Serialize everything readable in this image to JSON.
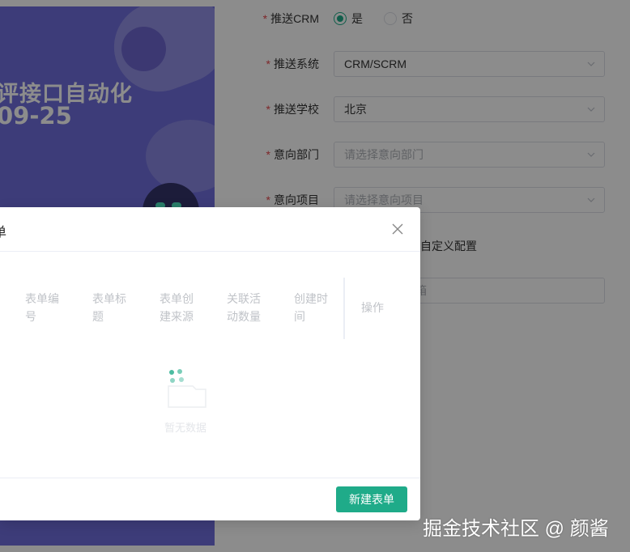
{
  "banner": {
    "title": "评接口自动化",
    "date": "09-25"
  },
  "form": {
    "push_crm": {
      "label": "推送CRM",
      "options": [
        {
          "label": "是",
          "checked": true
        },
        {
          "label": "否",
          "checked": false
        }
      ]
    },
    "push_system": {
      "label": "推送系统",
      "value": "CRM/SCRM"
    },
    "push_school": {
      "label": "推送学校",
      "value": "北京"
    },
    "intent_department": {
      "label": "意向部门",
      "placeholder": "请选择意向部门"
    },
    "intent_project": {
      "label": "意向项目",
      "placeholder": "请选择意向项目"
    },
    "custom_config_label": "自定义配置",
    "email_placeholder_fragment": "箱"
  },
  "dialog": {
    "title": "单",
    "columns": [
      "表单编号",
      "表单标题",
      "表单创建来源",
      "关联活动数量",
      "创建时间",
      "操作"
    ],
    "empty_text": "暂无数据",
    "create_button": "新建表单"
  },
  "watermark": "掘金技术社区 @ 颜酱",
  "colors": {
    "primary": "#1fab89",
    "required": "#e5484d",
    "banner": "#6f6ddc"
  }
}
